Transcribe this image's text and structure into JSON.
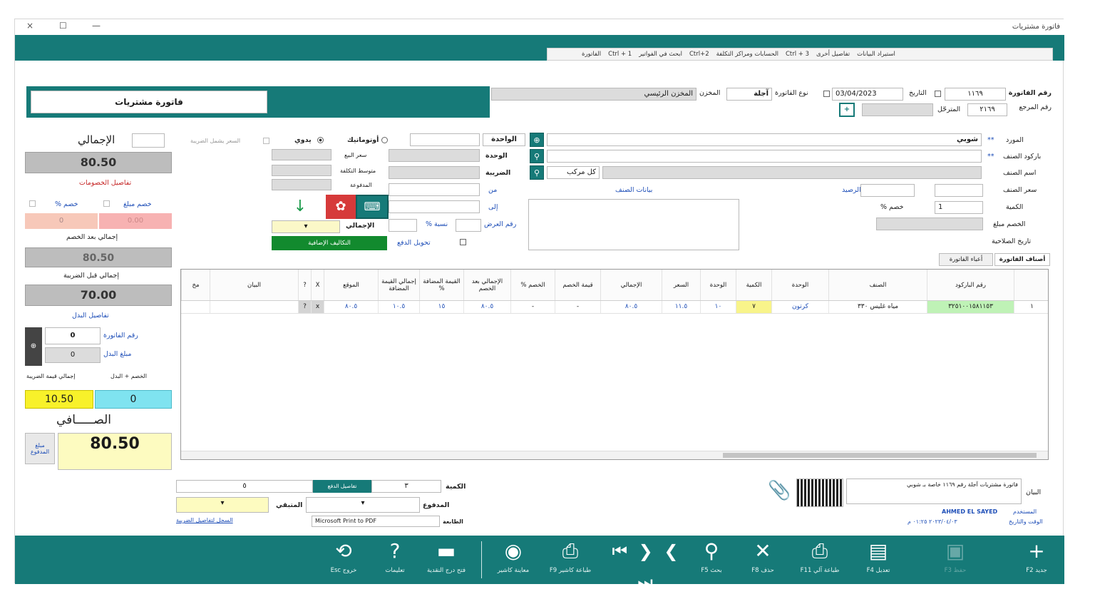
{
  "window": {
    "title": "فاتورة مشتريات",
    "controls": [
      "×",
      "☐",
      "—"
    ]
  },
  "ribbon": {
    "tabs": [
      "الفاتورة",
      "Ctrl + 1",
      "ابحث في الفواتير",
      "Ctrl+2",
      "الحسابات ومراكز التكلفة",
      "Ctrl + 3",
      "تفاصيل أخرى",
      "استيراد البيانات"
    ]
  },
  "document": {
    "title": "فاتورة مشتريات",
    "invoice_no_label": "رقم الفاتورة",
    "invoice_no": "١١٦٩",
    "date_label": "التاريخ",
    "date": "03/04/2023",
    "invoice_type_label": "نوع الفاتورة",
    "invoice_type": "آجلة",
    "warehouse_label": "المخزن",
    "warehouse": "المخزن الرئيسي",
    "ref_label": "رقم المرجع",
    "ref": "٢١٦٩",
    "posted_label": "المترحّل"
  },
  "entry": {
    "supplier_label": "المورد",
    "supplier": "شوبي",
    "barcode_label": "باركود الصنف",
    "item_name_label": "اسم الصنف",
    "item_price_label": "سعر الصنف",
    "qty_label": "الكمية",
    "qty": "1",
    "discount_amount_label": "الخصم مبلغ",
    "discount_pct_label": "خصم %",
    "expiry_label": "تاريخ الصلاحية",
    "unit_label": "الوحدة",
    "unit_value": "الواحدة",
    "tax_label": "الضريبة",
    "tax_value": "كل مركب",
    "from_label": "من",
    "to_label": "إلى",
    "notes_label": "بيانات الصنف",
    "balance_label": "الرصيد",
    "display_no_label": "رقم العرض",
    "pct_label": "نسبة %",
    "auto_label": "أوتوماتيك",
    "manual_label": "يدوي",
    "price_includes_tax": "السعر يشمل الضريبة",
    "sale_price_label": "سعر البيع",
    "avg_cost_label": "متوسط التكلفة",
    "total_label": "الإجمالي",
    "paid_label": "المدفوعة",
    "extra_costs_button": "التكاليف الإضافية",
    "auto_payment_check": "تحويل الدفع",
    "item_tabs": [
      "أصناف الفاتورة",
      "أعباء الفاتورة"
    ]
  },
  "totals": {
    "total_label": "الإجمالي",
    "total": "80.50",
    "discount_details_label": "تفاصيل الخصومات",
    "discount_pct_label": "خصم %",
    "discount_amount_label": "خصم مبلغ",
    "discount_pct": "0",
    "discount_amount": "0.00",
    "after_discount_label": "إجمالي بعد الخصم",
    "after_discount": "80.50",
    "before_tax_label": "إجمالي قبل الضريبة",
    "before_tax": "70.00",
    "return_details_label": "تفاصيل البدل",
    "return_invoice_label": "رقم الفاتورة",
    "return_invoice": "0",
    "return_amount_label": "مبلغ البدل",
    "return_amount": "0",
    "tax_total_label": "إجمالي قيمة الضريبة",
    "tax_total": "10.50",
    "balance_label": "الخصم + البدل",
    "balance": "0",
    "net_label": "الصـــــافي",
    "net": "80.50",
    "side_button": "مبلغ المدفوع"
  },
  "grid": {
    "columns": [
      "رقم الباركود",
      "الصنف",
      "الوحدة",
      "الكمية",
      "الوحدة",
      "السعر",
      "الإجمالي",
      "قيمة الخصم",
      "الخصم %",
      "الإجمالي بعد الخصم",
      "القيمة المضافة %",
      "إجمالي القيمة المضافة",
      "الموقع",
      "X",
      "?",
      "البيان",
      "مخ"
    ],
    "rows": [
      {
        "barcode": "٣٢٥١٠٠١٥٨١١٥٣",
        "item": "مياه غليس ٣٣٠",
        "unit": "كرتون",
        "qty": "٧",
        "unit_qty": "١٠",
        "price": "١١.٥",
        "total": "٨٠.٥",
        "disc_value": "-",
        "disc_pct": "-",
        "after_disc": "٨٠.٥",
        "vat_pct": "١٥",
        "vat_total": "١٠.٥",
        "location": "٨٠.٥",
        "row_index": "١"
      }
    ]
  },
  "footer": {
    "qty_label": "الكمية",
    "paid_label": "المدفوع",
    "remaining_label": "المتبقي",
    "printer_label": "الطابعة",
    "printer": "Microsoft Print to PDF",
    "tax_details_link": "السجل لتفاصيل الضريبة",
    "statement_label": "البيان",
    "statement": "فاتورة مشتريات آجلة رقم ١١٦٩ خاصة بـ شوبي",
    "user_label": "المستخدم",
    "user": "AHMED EL SAYED",
    "time_label": "الوقت والتاريخ",
    "time": "٢٠٢٣/٠٤/٠٣ ٠١:٢٥ م",
    "mid_btn": "تفاصيل الدفع"
  },
  "toolbar": {
    "items": [
      {
        "label": "جديد F2",
        "icon": "plus-icon"
      },
      {
        "label": "حفظ F3",
        "icon": "save-icon"
      },
      {
        "label": "تعديل F4",
        "icon": "edit-icon"
      },
      {
        "label": "طباعة آلي F11",
        "icon": "print-icon"
      },
      {
        "label": "حذف F8",
        "icon": "delete-icon"
      },
      {
        "label": "بحث F5",
        "icon": "search-icon"
      },
      {
        "label": "طباعة كاشير F9",
        "icon": "receipt-print-icon"
      },
      {
        "label": "معاينة كاشير",
        "icon": "preview-icon"
      },
      {
        "label": "فتح درج النقدية",
        "icon": "cash-drawer-icon"
      },
      {
        "label": "تعليمات",
        "icon": "help-icon"
      },
      {
        "label": "خروج Esc",
        "icon": "exit-icon"
      }
    ]
  },
  "colors": {
    "teal": "#167a78",
    "yellow": "#f8f48a",
    "cyan": "#7fe3f0",
    "salmon": "#f7c8b9"
  }
}
